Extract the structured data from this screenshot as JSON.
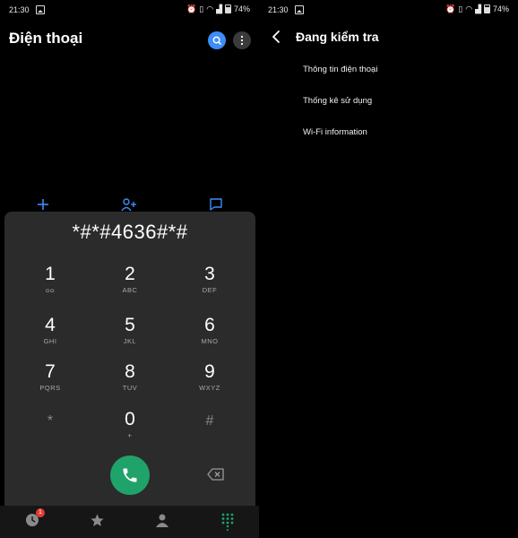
{
  "left": {
    "status": {
      "time": "21:30",
      "battery": "74%"
    },
    "title": "Điện thoại",
    "dial_input": "*#*#4636#*#",
    "keys": [
      {
        "num": "1",
        "sub": "ᴑᴑ"
      },
      {
        "num": "2",
        "sub": "ABC"
      },
      {
        "num": "3",
        "sub": "DEF"
      },
      {
        "num": "4",
        "sub": "GHI"
      },
      {
        "num": "5",
        "sub": "JKL"
      },
      {
        "num": "6",
        "sub": "MNO"
      },
      {
        "num": "7",
        "sub": "PQRS"
      },
      {
        "num": "8",
        "sub": "TUV"
      },
      {
        "num": "9",
        "sub": "WXYZ"
      },
      {
        "num": "*",
        "sub": ""
      },
      {
        "num": "0",
        "sub": "+"
      },
      {
        "num": "#",
        "sub": ""
      }
    ],
    "recents_badge": "1",
    "accent_blue": "#3d8ef7",
    "call_green": "#1fa36b"
  },
  "right": {
    "status": {
      "time": "21:30",
      "battery": "74%"
    },
    "title": "Đang kiểm tra",
    "menu": [
      "Thông tin điện thoại",
      "Thống kê sử dụng",
      "Wi-Fi information"
    ]
  }
}
